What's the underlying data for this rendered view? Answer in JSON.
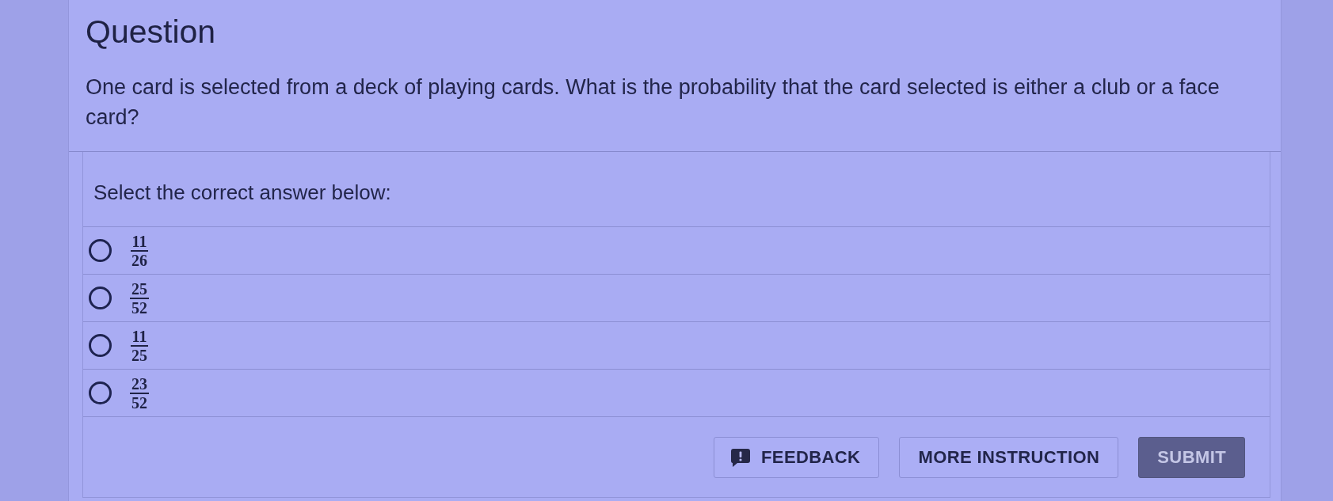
{
  "question": {
    "heading": "Question",
    "prompt": "One card is selected from a deck of playing cards. What is the probability that the card selected is either a club or a face card?"
  },
  "answer": {
    "instruction": "Select the correct answer below:",
    "options": [
      {
        "numerator": "11",
        "denominator": "26",
        "selected": false
      },
      {
        "numerator": "25",
        "denominator": "52",
        "selected": false
      },
      {
        "numerator": "11",
        "denominator": "25",
        "selected": false
      },
      {
        "numerator": "23",
        "denominator": "52",
        "selected": false
      }
    ]
  },
  "actions": [
    {
      "kind": "feedback",
      "label": "FEEDBACK"
    },
    {
      "kind": "outline",
      "label": "MORE INSTRUCTION"
    },
    {
      "kind": "filled",
      "label": "SUBMIT"
    }
  ]
}
